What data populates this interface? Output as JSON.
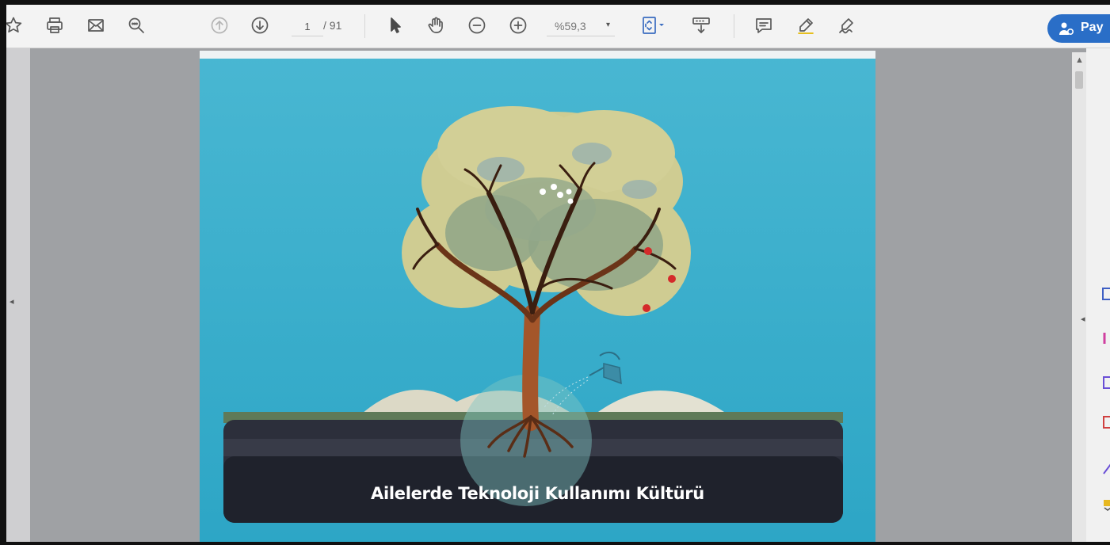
{
  "toolbar": {
    "page_current": "1",
    "page_total": "/ 91",
    "zoom_value": "%59,3",
    "zoom_caret": "▾",
    "share_label": "Pay",
    "icons": [
      "star-icon",
      "print-icon",
      "email-icon",
      "find-icon",
      "page-up-icon",
      "page-down-icon",
      "select-cursor-icon",
      "hand-tool-icon",
      "zoom-out-icon",
      "zoom-in-icon",
      "fit-page-icon",
      "scroll-mode-icon",
      "comment-icon",
      "highlight-icon",
      "sign-icon",
      "share-icon"
    ]
  },
  "document": {
    "slide_caption": "Ailelerde Teknoloji Kullanımı Kültürü",
    "colors": {
      "background": "#3fb1cd",
      "ground": "#2c2f3b",
      "caption_band": "#1f222c",
      "foliage": "#cfcc92",
      "trunk": "#a4562a",
      "apple": "#d42a2a"
    }
  },
  "side_panel": {
    "icons": [
      "expand-panel-icon",
      "export-icon",
      "edit-pdf-icon",
      "organize-icon",
      "fill-sign-icon",
      "more-tools-icon"
    ]
  }
}
